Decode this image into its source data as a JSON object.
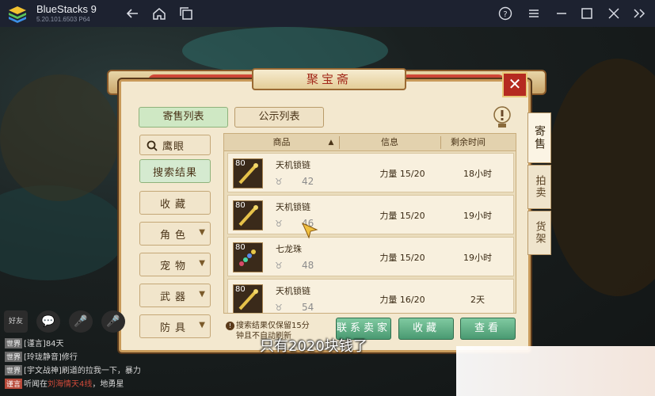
{
  "titlebar": {
    "app_name": "BlueStacks 9",
    "version": "5.20.101.6503 P64",
    "icons": [
      "back-icon",
      "home-icon",
      "multi-instance-icon",
      "help-icon",
      "menu-icon",
      "minimize-icon",
      "maximize-icon",
      "close-icon",
      "sidebar-toggle-icon"
    ]
  },
  "dialog": {
    "title": "聚宝斋",
    "close_label": "✕",
    "tabs": [
      {
        "label": "寄售列表",
        "active": true
      },
      {
        "label": "公示列表",
        "active": false
      }
    ],
    "side_tabs": [
      {
        "label": "寄售",
        "active": true
      },
      {
        "label": "拍卖",
        "active": false
      },
      {
        "label": "货架",
        "active": false
      }
    ],
    "left_menu": [
      {
        "label": "鹰眼",
        "type": "search"
      },
      {
        "label": "搜索结果",
        "active": true
      },
      {
        "label": "收藏"
      },
      {
        "label": "角色",
        "dropdown": true
      },
      {
        "label": "宠物",
        "dropdown": true
      },
      {
        "label": "武器",
        "dropdown": true
      },
      {
        "label": "防具",
        "dropdown": true
      }
    ],
    "table": {
      "columns": [
        "商品",
        "信息",
        "剩余时间"
      ],
      "sort_indicator": "▲",
      "rows": [
        {
          "level": "80",
          "name": "天机锁链",
          "price": "42",
          "info": "力量 15/20",
          "time": "18小时"
        },
        {
          "level": "80",
          "name": "天机锁链",
          "price": "46",
          "info": "力量 15/20",
          "time": "19小时"
        },
        {
          "level": "80",
          "name": "七龙珠",
          "price": "48",
          "info": "力量 15/20",
          "time": "19小时"
        },
        {
          "level": "80",
          "name": "天机锁链",
          "price": "54",
          "info": "力量 16/20",
          "time": "2天"
        }
      ]
    },
    "notice": {
      "line1": "搜索结果仅保留15分",
      "line2": "钟且不自动刷新"
    },
    "buttons": {
      "contact_seller": "联系卖家",
      "favorite": "收藏",
      "view": "查看"
    }
  },
  "chat": {
    "buttons": [
      "好友",
      "💬",
      "🎤",
      "🎤"
    ],
    "lines": [
      {
        "tag": "世界",
        "text": "[谨言]84天"
      },
      {
        "tag": "世界",
        "text": "[玲珑静音]修行"
      },
      {
        "tag": "世界",
        "text": "[宇文战神]刷道的拉我一下，暴力"
      },
      {
        "tag": "谨言",
        "text": "听闻在",
        "highlight": "刘海情天4线",
        "suffix": "，地勇星"
      }
    ]
  },
  "subtitle": "只有2020块钱了",
  "colors": {
    "accent_green": "#4a9a72",
    "title_red": "#a32b1c",
    "panel_bg": "#f3e8cf"
  }
}
